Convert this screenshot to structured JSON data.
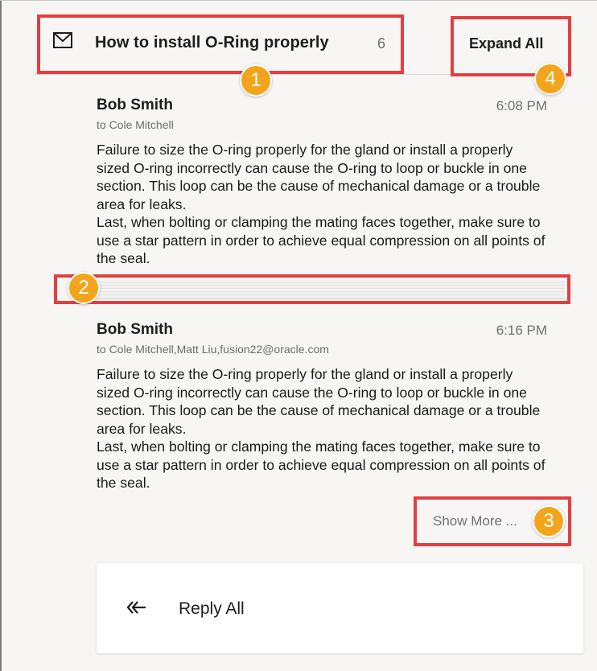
{
  "thread": {
    "title": "How to install O-Ring properly",
    "count": "6",
    "expand_all_label": "Expand All"
  },
  "messages": [
    {
      "sender": "Bob Smith",
      "time": "6:08 PM",
      "to": "to Cole Mitchell",
      "body_lines": [
        "Failure to size the O-ring properly for the gland or install a properly sized O-ring incorrectly can cause the O-ring to loop or buckle in one section. This loop can be the cause of mechanical damage or a trouble area for leaks.",
        "Last, when bolting or clamping the mating faces together, make sure to use a star pattern in order to achieve equal compression on all points of the seal."
      ]
    },
    {
      "sender": "Bob Smith",
      "time": "6:16 PM",
      "to": "to Cole Mitchell,Matt Liu,fusion22@oracle.com",
      "body_lines": [
        "Failure to size the O-ring properly for the gland or install a properly sized O-ring incorrectly can cause the O-ring to loop or buckle in one section. This loop can be the cause of mechanical damage or a trouble area for leaks.",
        "Last, when bolting or clamping the mating faces together, make sure to use a star pattern in order to achieve equal compression on all points of the seal."
      ]
    }
  ],
  "show_more_label": "Show More ...",
  "reply": {
    "label": "Reply All",
    "icon": "reply-all-icon"
  },
  "callouts": {
    "badge_1": "1",
    "badge_2": "2",
    "badge_3": "3",
    "badge_4": "4"
  },
  "colors": {
    "callout_border": "#e23f3f",
    "badge_fill": "#f2a51c"
  }
}
